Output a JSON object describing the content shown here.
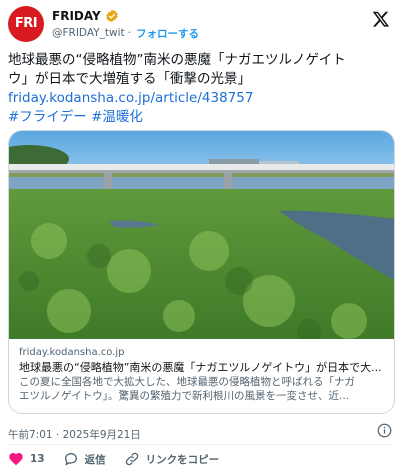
{
  "account": {
    "avatar_text": "FRI",
    "display_name": "FRIDAY",
    "handle": "@FRIDAY_twit",
    "separator": "·",
    "follow_label": "フォローする",
    "avatar_color": "#d71920"
  },
  "tweet": {
    "text_line1": "地球最悪の“侵略植物”南米の悪魔「ナガエツルノゲイト",
    "text_line2": "ウ」が日本で大増殖する「衝撃の光景」",
    "link": "friday.kodansha.co.jp/article/438757",
    "hashtags": "#フライデー #温暖化"
  },
  "card": {
    "domain": "friday.kodansha.co.jp",
    "title": "地球最悪の“侵略植物”南米の悪魔「ナガエツルノゲイトウ」が日本で大...",
    "desc_line1": "この夏に全国各地で大拡大した、地球最悪の侵略植物と呼ばれる「ナガ",
    "desc_line2": "エツルノゲイトウ」。驚異の繁殖力で新利根川の風景を一変させ、近..."
  },
  "meta": {
    "timestamp": "午前7:01 · 2025年9月21日"
  },
  "actions": {
    "like_count": "13",
    "reply_label": "返信",
    "copy_link_label": "リンクをコピー"
  },
  "colors": {
    "link": "#1d6fd6",
    "like": "#f91880",
    "verified": "#e6a817"
  }
}
